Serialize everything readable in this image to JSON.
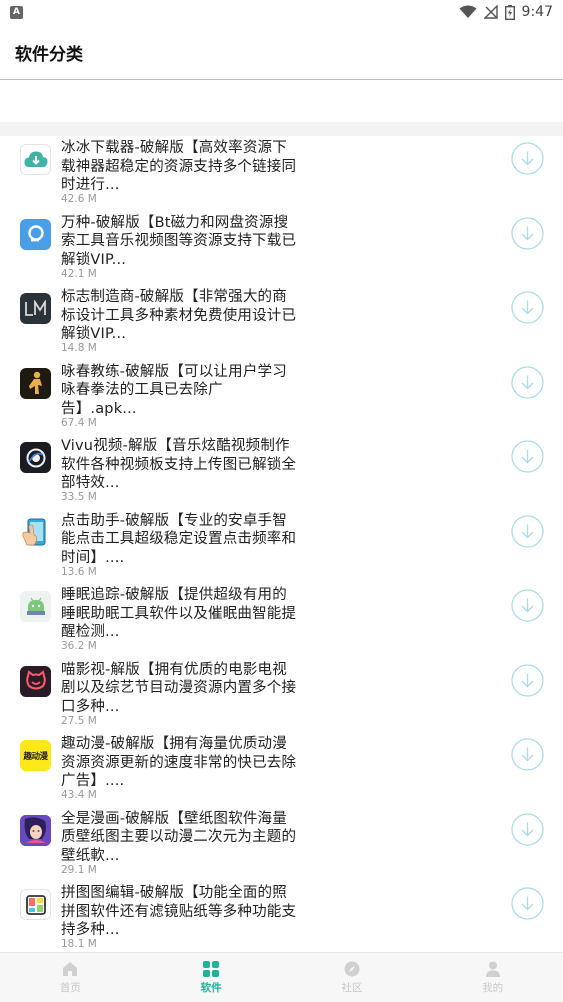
{
  "status_bar": {
    "time": "9:47",
    "left_badge": "A"
  },
  "header": {
    "title": "软件分类"
  },
  "colors": {
    "accent": "#1fb39c",
    "download_ring": "#a9dcf0"
  },
  "apps": [
    {
      "title": "冰冰下载器-破解版【高效率资源下载神器超稳定的资源支持多个链接同时进行...",
      "size": "42.6 M",
      "icon": "cloud-download-app-icon"
    },
    {
      "title": "万种-破解版【Bt磁力和网盘资源搜索工具音乐视频图等资源支持下载已解锁VIP...",
      "size": "42.1 M",
      "icon": "search-app-icon"
    },
    {
      "title": "标志制造商-破解版【非常强大的商标设计工具多种素材免费使用设计已解锁VIP...",
      "size": "14.8 M",
      "icon": "logo-maker-app-icon"
    },
    {
      "title": "咏春教练-破解版【可以让用户学习咏春拳法的工具已去除广告】.apk...",
      "size": "67.4 M",
      "icon": "wing-chun-app-icon"
    },
    {
      "title": "Vivu视频-解版【音乐炫酷视频制作软件各种视频板支持上传图已解锁全部特效...",
      "size": "33.5 M",
      "icon": "vivu-video-app-icon"
    },
    {
      "title": "点击助手-破解版【专业的安卓手智能点击工具超级稳定设置点击频率和时间】....",
      "size": "13.6 M",
      "icon": "click-assistant-app-icon"
    },
    {
      "title": "睡眠追踪-破解版【提供超级有用的睡眠助眠工具软件以及催眠曲智能提醒检测...",
      "size": "36.2 M",
      "icon": "sleep-tracker-app-icon"
    },
    {
      "title": "喵影视-解版【拥有优质的电影电视剧以及综艺节目动漫资源内置多个接口多种...",
      "size": "27.5 M",
      "icon": "cat-video-app-icon"
    },
    {
      "title": "趣动漫-破解版【拥有海量优质动漫资源资源更新的速度非常的快已去除广告】....",
      "size": "43.4 M",
      "icon": "qu-anime-app-icon",
      "icon_text": "趣动漫"
    },
    {
      "title": "全是漫画-破解版【壁纸图软件海量质壁纸图主要以动漫二次元为主题的壁纸軟...",
      "size": "29.1 M",
      "icon": "comic-app-icon"
    },
    {
      "title": "拼图图编辑-破解版【功能全面的照拼图软件还有滤镜贴纸等多种功能支持多种...",
      "size": "18.1 M",
      "icon": "puzzle-editor-app-icon"
    }
  ],
  "tabs": [
    {
      "label": "首页",
      "icon": "home-icon",
      "active": false
    },
    {
      "label": "软件",
      "icon": "apps-grid-icon",
      "active": true
    },
    {
      "label": "社区",
      "icon": "compass-icon",
      "active": false
    },
    {
      "label": "我的",
      "icon": "user-icon",
      "active": false
    }
  ]
}
